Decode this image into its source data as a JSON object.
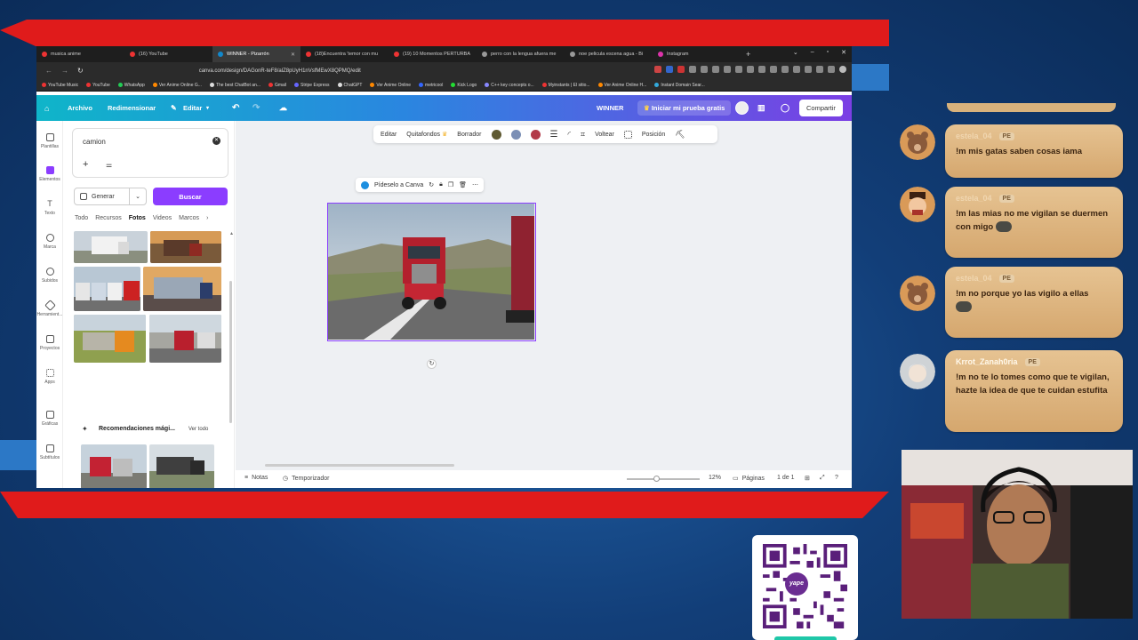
{
  "browser": {
    "tabs": [
      {
        "label": "musica anime",
        "color": "#e33"
      },
      {
        "label": "(16) YouTube",
        "color": "#e33"
      },
      {
        "label": "WINNER - Pizarrón",
        "color": "#18c",
        "active": true
      },
      {
        "label": "(18)Encuentra 'temor con mu",
        "color": "#e33"
      },
      {
        "label": "(19) 10 Momentos PERTURBA",
        "color": "#e33"
      },
      {
        "label": "perro con la lengua afuera me",
        "color": "#999"
      },
      {
        "label": "noe pelicula escena agua - Bi",
        "color": "#999"
      },
      {
        "label": "Instagram",
        "color": "#d3a"
      }
    ],
    "url": "canva.com/design/DAGonR-teF8/alZ8pUyH1nVsfMEwX8QPMQ/edit",
    "bookmarks": [
      {
        "label": "YouTube Music",
        "color": "#e33"
      },
      {
        "label": "YouTube",
        "color": "#e33"
      },
      {
        "label": "WhatsApp",
        "color": "#2c5"
      },
      {
        "label": "Ver Anime Online G...",
        "color": "#f80"
      },
      {
        "label": "The best ChatBot an...",
        "color": "#ddd"
      },
      {
        "label": "Gmail",
        "color": "#e33"
      },
      {
        "label": "Stripe Express",
        "color": "#66f"
      },
      {
        "label": "ChatGPT",
        "color": "#ddd"
      },
      {
        "label": "Ver Anime Online",
        "color": "#f80"
      },
      {
        "label": "metricool",
        "color": "#36f"
      },
      {
        "label": "Kick Logo",
        "color": "#2d3"
      },
      {
        "label": "C++ key concepts o...",
        "color": "#88f"
      },
      {
        "label": "Myinstants | El sitio...",
        "color": "#e33"
      },
      {
        "label": "Ver Anime Online H...",
        "color": "#f80"
      },
      {
        "label": "Instant Domain Sear...",
        "color": "#3ad"
      }
    ]
  },
  "canva": {
    "header": {
      "archivo": "Archivo",
      "redimensionar": "Redimensionar",
      "editar": "Editar",
      "title": "WINNER",
      "trial": "Iniciar mi prueba gratis",
      "share": "Compartir"
    },
    "rail": [
      "Plantillas",
      "Elementos",
      "Texto",
      "Marca",
      "Subidos",
      "Herramient...",
      "Proyectos",
      "Apps",
      "Gráficas",
      "Subtítulos"
    ],
    "panel": {
      "search_value": "camion",
      "generate": "Generar",
      "search_button": "Buscar",
      "tabs": [
        "Todo",
        "Recursos",
        "Fotos",
        "Videos",
        "Marcos"
      ],
      "reco_title": "Recomendaciones mági...",
      "reco_all": "Ver todo"
    },
    "toolbar": {
      "editar": "Editar",
      "quitafondos": "Quitafondos",
      "borrador": "Borrador",
      "voltear": "Voltear",
      "posicion": "Posición",
      "colors": [
        "#5f5a32",
        "#7b8fb5",
        "#b23a48"
      ]
    },
    "float_toolbar": {
      "label": "Pídeselo a Canva"
    },
    "footer": {
      "notas": "Notas",
      "temporizador": "Temporizador",
      "zoom": "12%",
      "paginas": "Páginas",
      "page_count": "1 de 1"
    }
  },
  "chat": [
    {
      "user": "estela_04",
      "badge": "PE",
      "text": "!m mis gatas saben cosas iama"
    },
    {
      "user": "estela_04",
      "badge": "PE",
      "text": "!m las mias no me vigilan se duermen con migo"
    },
    {
      "user": "estela_04",
      "badge": "PE",
      "text": "!m no porque yo las vigilo a ellas"
    },
    {
      "user": "Krrot_Zanah0ria",
      "badge": "PE",
      "text": "!m no te lo tomes como que te vigilan, hazte la idea de que te cuidan estufita"
    }
  ],
  "qr": {
    "badge": "yape"
  }
}
